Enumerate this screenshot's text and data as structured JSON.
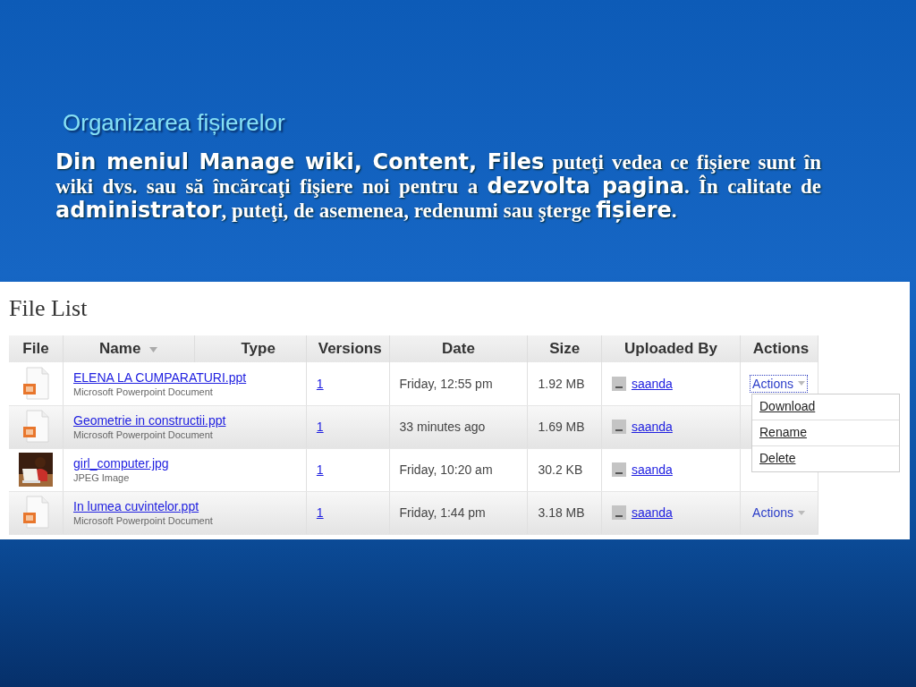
{
  "slide": {
    "heading": "Organizarea fișierelor",
    "paragraph": "**Din meniul Manage wiki,  Content, Files** puteţi vedea ce fişiere sunt în wiki dvs. sau să încărcaţi fişiere noi pentru a **dezvolta pagina**. În calitate de **administrator**, puteţi, de asemenea, redenumi sau şterge **fișiere**."
  },
  "file_list": {
    "title": "File List",
    "columns": [
      {
        "label": "File"
      },
      {
        "label": "Name",
        "sort_icon": true
      },
      {
        "label": "Type"
      },
      {
        "label": "Versions"
      },
      {
        "label": "Date"
      },
      {
        "label": "Size"
      },
      {
        "label": "Uploaded By"
      },
      {
        "label": "Actions"
      }
    ],
    "rows": [
      {
        "kind": "document",
        "name": "ELENA LA CUMPARATURI.ppt",
        "type": "Microsoft Powerpoint Document",
        "versions": "1",
        "date": "Friday, 12:55 pm",
        "size": "1.92 MB",
        "uploaded_by": "saanda",
        "actions": "Actions",
        "focused": true
      },
      {
        "kind": "document",
        "name": "Geometrie in constructii.ppt",
        "type": "Microsoft Powerpoint Document",
        "versions": "1",
        "date": "33 minutes ago",
        "size": "1.69 MB",
        "uploaded_by": "saanda"
      },
      {
        "kind": "picture",
        "name": "girl_computer.jpg",
        "type": "JPEG Image",
        "versions": "1",
        "date": "Friday, 10:20 am",
        "size": "30.2 KB",
        "uploaded_by": "saanda"
      },
      {
        "kind": "document",
        "name": "In lumea cuvintelor.ppt",
        "type": "Microsoft Powerpoint Document",
        "versions": "1",
        "date": "Friday, 1:44 pm",
        "size": "3.18 MB",
        "uploaded_by": "saanda",
        "actions": "Actions",
        "focused": false
      }
    ],
    "actions_menu": [
      "Download",
      "Rename",
      "Delete"
    ]
  }
}
